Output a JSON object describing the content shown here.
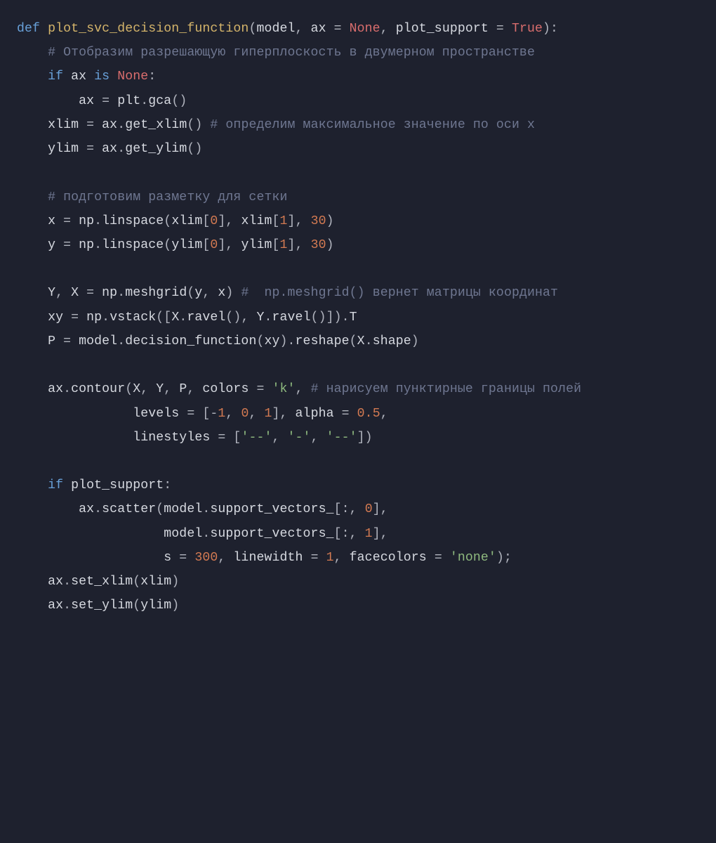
{
  "code": {
    "kw_def": "def",
    "fn_name": "plot_svc_decision_function",
    "param_model": "model",
    "param_ax": "ax",
    "eq": " = ",
    "kw_none": "None",
    "param_plot_support": "plot_support",
    "kw_true": "True",
    "c_desc1": "# Отобразим разрешающую гиперплоскость в двумерном пространстве",
    "kw_if": "if",
    "id_ax": "ax",
    "kw_is": "is",
    "id_plt": "plt",
    "m_gca": "gca",
    "id_xlim": "xlim",
    "m_get_xlim": "get_xlim",
    "c_xlim": "# определим максимальное значение по оси x",
    "id_ylim": "ylim",
    "m_get_ylim": "get_ylim",
    "c_grid": "# подготовим разметку для сетки",
    "id_x": "x",
    "id_np": "np",
    "m_linspace": "linspace",
    "n_0": "0",
    "n_1": "1",
    "n_30": "30",
    "id_y": "y",
    "id_Y": "Y",
    "id_X": "X",
    "m_meshgrid": "meshgrid",
    "c_mesh": "#  np.meshgrid() вернет матрицы координат",
    "id_xy": "xy",
    "m_vstack": "vstack",
    "m_ravel": "ravel",
    "attr_T": "T",
    "id_P": "P",
    "id_model": "model",
    "m_decision_function": "decision_function",
    "m_reshape": "reshape",
    "attr_shape": "shape",
    "m_contour": "contour",
    "kw_colors": "colors",
    "s_k": "'k'",
    "c_contour": "# нарисуем пунктирные границы полей",
    "kw_levels": "levels",
    "n_m1": "-1",
    "kw_alpha": "alpha",
    "n_0_5": "0.5",
    "kw_linestyles": "linestyles",
    "s_dd1": "'--'",
    "s_d": "'-'",
    "s_dd2": "'--'",
    "m_scatter": "scatter",
    "attr_support_vectors": "support_vectors_",
    "kw_s": "s",
    "n_300": "300",
    "kw_linewidth": "linewidth",
    "kw_facecolors": "facecolors",
    "s_none": "'none'",
    "m_set_xlim": "set_xlim",
    "m_set_ylim": "set_ylim"
  }
}
